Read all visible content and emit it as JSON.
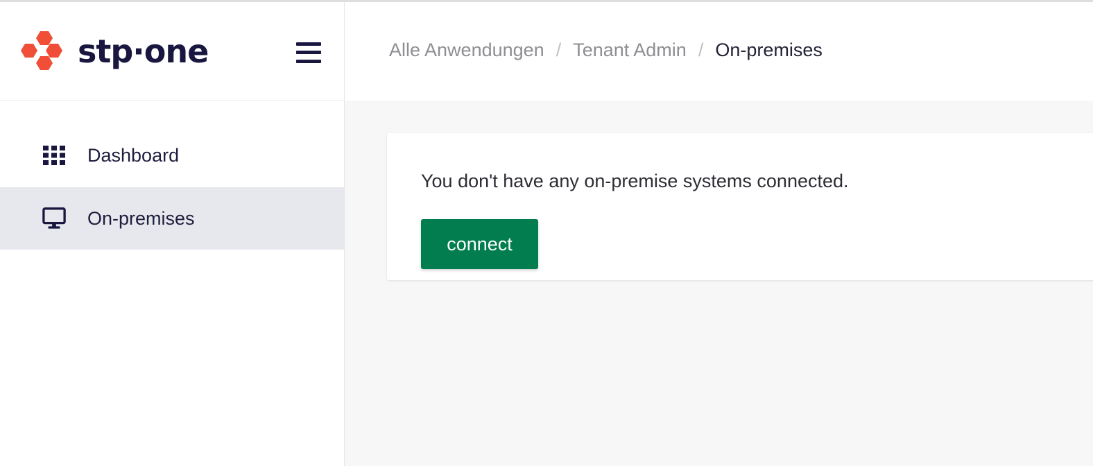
{
  "brand": {
    "name": "stp·one",
    "logo_color": "#f04e37",
    "text_color": "#19173f"
  },
  "header": {
    "menu_icon": "hamburger-menu-icon",
    "breadcrumb": {
      "items": [
        "Alle Anwendungen",
        "Tenant Admin"
      ],
      "current": "On-premises",
      "separator": "/"
    }
  },
  "sidebar": {
    "items": [
      {
        "label": "Dashboard",
        "icon": "grid-icon",
        "active": false
      },
      {
        "label": "On-premises",
        "icon": "monitor-icon",
        "active": true
      }
    ]
  },
  "main": {
    "empty_message": "You don't have any on-premise systems connected.",
    "connect_label": "connect",
    "accent_color": "#017d50"
  }
}
